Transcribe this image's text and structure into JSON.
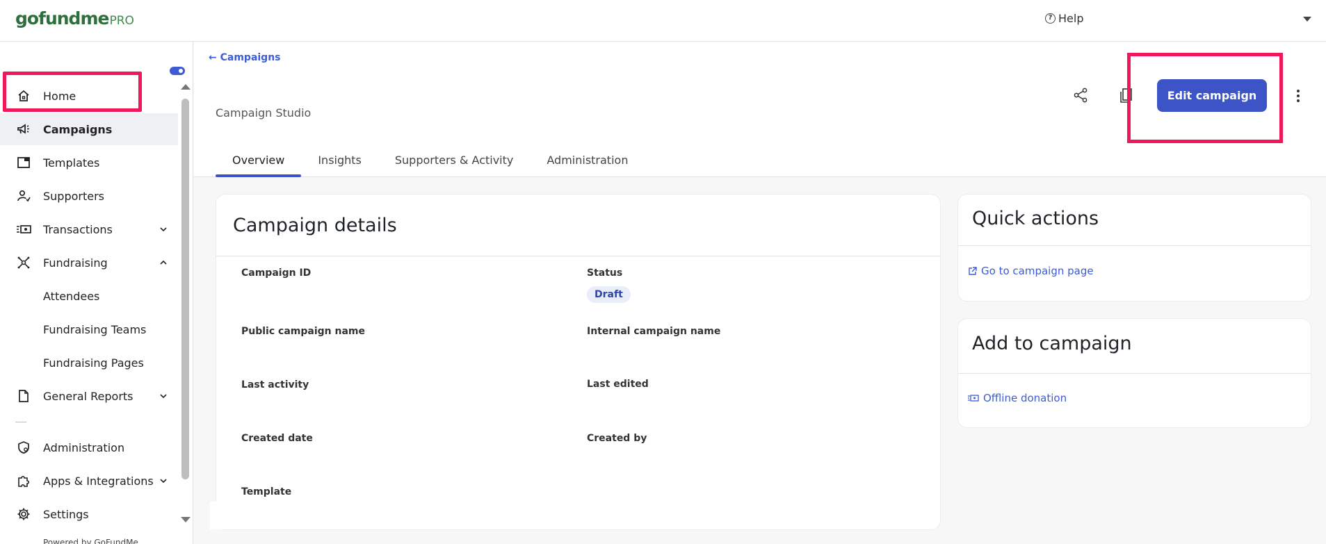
{
  "header": {
    "logo_text": "gofundme",
    "logo_pro": "PRO",
    "help_label": "Help"
  },
  "sidebar": {
    "items": [
      {
        "label": "Home"
      },
      {
        "label": "Campaigns"
      },
      {
        "label": "Templates"
      },
      {
        "label": "Supporters"
      },
      {
        "label": "Transactions"
      },
      {
        "label": "Fundraising"
      },
      {
        "label": "Attendees"
      },
      {
        "label": "Fundraising Teams"
      },
      {
        "label": "Fundraising Pages"
      },
      {
        "label": "General Reports"
      },
      {
        "label": "Administration"
      },
      {
        "label": "Apps & Integrations"
      },
      {
        "label": "Settings"
      }
    ],
    "powered_by": "Powered by GoFundMe"
  },
  "main": {
    "back_link": "Campaigns",
    "studio_title": "Campaign Studio",
    "edit_button": "Edit campaign",
    "tabs": [
      {
        "label": "Overview"
      },
      {
        "label": "Insights"
      },
      {
        "label": "Supporters & Activity"
      },
      {
        "label": "Administration"
      }
    ]
  },
  "details": {
    "title": "Campaign details",
    "fields": {
      "campaign_id": "Campaign ID",
      "status": "Status",
      "status_value": "Draft",
      "public_name": "Public campaign name",
      "internal_name": "Internal campaign name",
      "last_activity": "Last activity",
      "last_edited": "Last edited",
      "created_date": "Created date",
      "created_by": "Created by",
      "template": "Template"
    }
  },
  "quick_actions": {
    "title": "Quick actions",
    "link": "Go to campaign page"
  },
  "add_to_campaign": {
    "title": "Add to campaign",
    "link": "Offline donation"
  },
  "colors": {
    "accent": "#3d54c7",
    "highlight": "#f0185a",
    "brand_green": "#2f6f3e"
  }
}
